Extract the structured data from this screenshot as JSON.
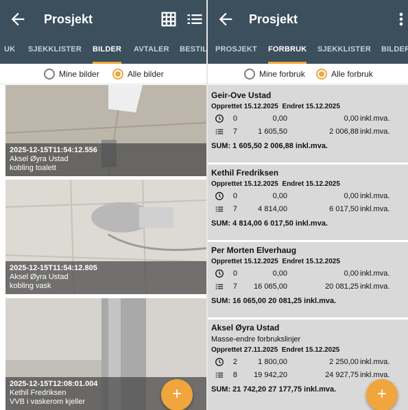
{
  "left": {
    "title": "Prosjekt",
    "tabs": [
      "UK",
      "SJEKKLISTER",
      "BILDER",
      "AVTALER",
      "BESTIL"
    ],
    "active_tab": "BILDER",
    "filter": {
      "option1": "Mine bilder",
      "option2": "Alle bilder",
      "selected": "Alle bilder"
    },
    "photos": [
      {
        "timestamp": "2025-12-15T11:54:12.556",
        "user": "Aksel Øyra Ustad",
        "description": "kobling toalett"
      },
      {
        "timestamp": "2025-12-15T11:54:12.805",
        "user": "Aksel Øyra Ustad",
        "description": "kobling vask"
      },
      {
        "timestamp": "2025-12-15T12:08:01.004",
        "user": "Kethil Fredriksen",
        "description": "VVB i vaskerom kjeller"
      }
    ],
    "fab_label": "+"
  },
  "right": {
    "title": "Prosjekt",
    "tabs": [
      "PROSJEKT",
      "FORBRUK",
      "SJEKKLISTER",
      "BILDER"
    ],
    "active_tab": "FORBRUK",
    "filter": {
      "option1": "Mine forbruk",
      "option2": "Alle forbruk",
      "selected": "Alle forbruk"
    },
    "labels": {
      "created": "Opprettet",
      "changed": "Endret",
      "inkl": "inkl.mva."
    },
    "entries": [
      {
        "name": "Geir-Ove Ustad",
        "note": "",
        "created": "15.12.2025",
        "changed": "15.12.2025",
        "hours": {
          "count": "0",
          "ex": "0,00",
          "inc": "0,00"
        },
        "items": {
          "count": "7",
          "ex": "1 605,50",
          "inc": "2 006,88"
        },
        "sum": "SUM: 1 605,50  2 006,88 inkl.mva."
      },
      {
        "name": "Kethil Fredriksen",
        "note": "",
        "created": "15.12.2025",
        "changed": "15.12.2025",
        "hours": {
          "count": "0",
          "ex": "0,00",
          "inc": "0,00"
        },
        "items": {
          "count": "7",
          "ex": "4 814,00",
          "inc": "6 017,50"
        },
        "sum": "SUM: 4 814,00  6 017,50 inkl.mva."
      },
      {
        "name": "Per Morten Elverhaug",
        "note": "",
        "created": "15.12.2025",
        "changed": "15.12.2025",
        "hours": {
          "count": "0",
          "ex": "0,00",
          "inc": "0,00"
        },
        "items": {
          "count": "7",
          "ex": "16 065,00",
          "inc": "20 081,25"
        },
        "sum": "SUM: 16 065,00  20 081,25 inkl.mva."
      },
      {
        "name": "Aksel Øyra Ustad",
        "note": "Masse-endre forbrukslinjer",
        "created": "27.11.2025",
        "changed": "15.12.2025",
        "hours": {
          "count": "2",
          "ex": "1 800,00",
          "inc": "2 250,00"
        },
        "items": {
          "count": "8",
          "ex": "19 942,20",
          "inc": "24 927,75"
        },
        "sum": "SUM: 21 742,20  27 177,75 inkl.mva."
      }
    ],
    "fab_label": "+"
  },
  "colors": {
    "appbar": "#3b4f5c",
    "accent": "#f0a63c",
    "list_bg": "#d9d9d9"
  },
  "icons": {
    "back": "arrow-left-icon",
    "grid": "grid-icon",
    "list": "list-icon",
    "more": "more-vert-icon",
    "hours": "clock-icon",
    "items": "list-lines-icon",
    "add": "plus-icon"
  }
}
